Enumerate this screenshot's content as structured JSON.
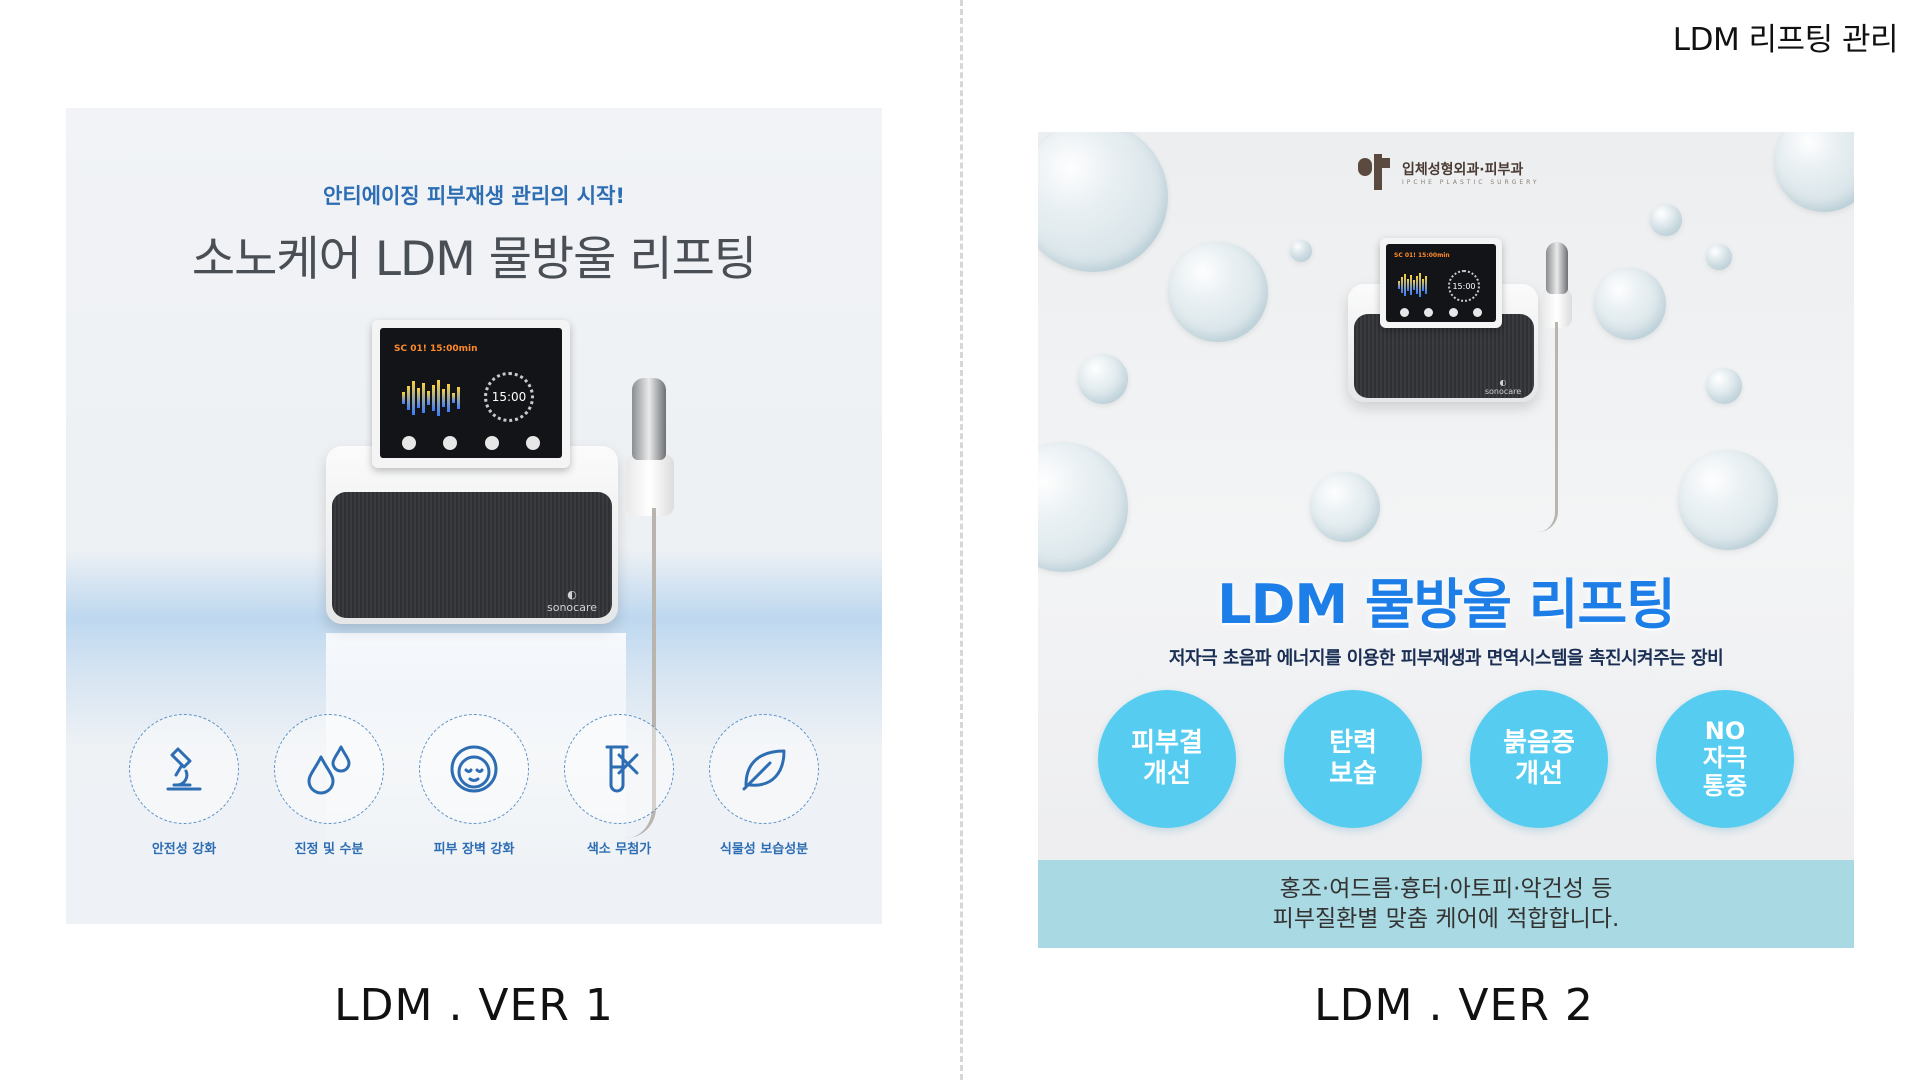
{
  "header": {
    "title": "LDM 리프팅 관리"
  },
  "versions": [
    {
      "label": "LDM . VER 1"
    },
    {
      "label": "LDM . VER 2"
    }
  ],
  "panel1": {
    "subtitle": "안티에이징 피부재생 관리의 시작!",
    "title": "소노케어 LDM 물방울 리프팅",
    "device": {
      "screen_header": "SC 01!  15:00min",
      "timer": "15:00",
      "brand": "sonocare"
    },
    "features": [
      {
        "label": "안전성 강화",
        "icon": "microscope-icon"
      },
      {
        "label": "진정 및 수분",
        "icon": "water-drops-icon"
      },
      {
        "label": "피부 장벽 강화",
        "icon": "face-icon"
      },
      {
        "label": "색소 무첨가",
        "icon": "no-dye-test-tube-icon"
      },
      {
        "label": "식물성 보습성분",
        "icon": "leaf-icon"
      }
    ],
    "colors": {
      "accent": "#2d6db3"
    }
  },
  "panel2": {
    "logo_text": "입체성형외과·피부과",
    "logo_sub": "IPCHE PLASTIC SURGERY",
    "device": {
      "screen_header": "SC 01!  15:00min",
      "timer": "15:00",
      "brand": "sonocare"
    },
    "title": "LDM 물방울 리프팅",
    "description": "저자극 초음파 에너지를 이용한 피부재생과 면역시스템을 촉진시켜주는 장비",
    "benefits": [
      {
        "label": "피부결\n개선"
      },
      {
        "label": "탄력\n보습"
      },
      {
        "label": "붉음증\n개선"
      },
      {
        "label": "NO\n자극\n통증"
      }
    ],
    "footer": "홍조·여드름·흉터·아토피·악건성 등\n피부질환별 맞춤 케어에 적합합니다.",
    "colors": {
      "title": "#1e7ee8",
      "circle": "#56cdf0",
      "footer_bg": "#a9d9e2"
    }
  }
}
